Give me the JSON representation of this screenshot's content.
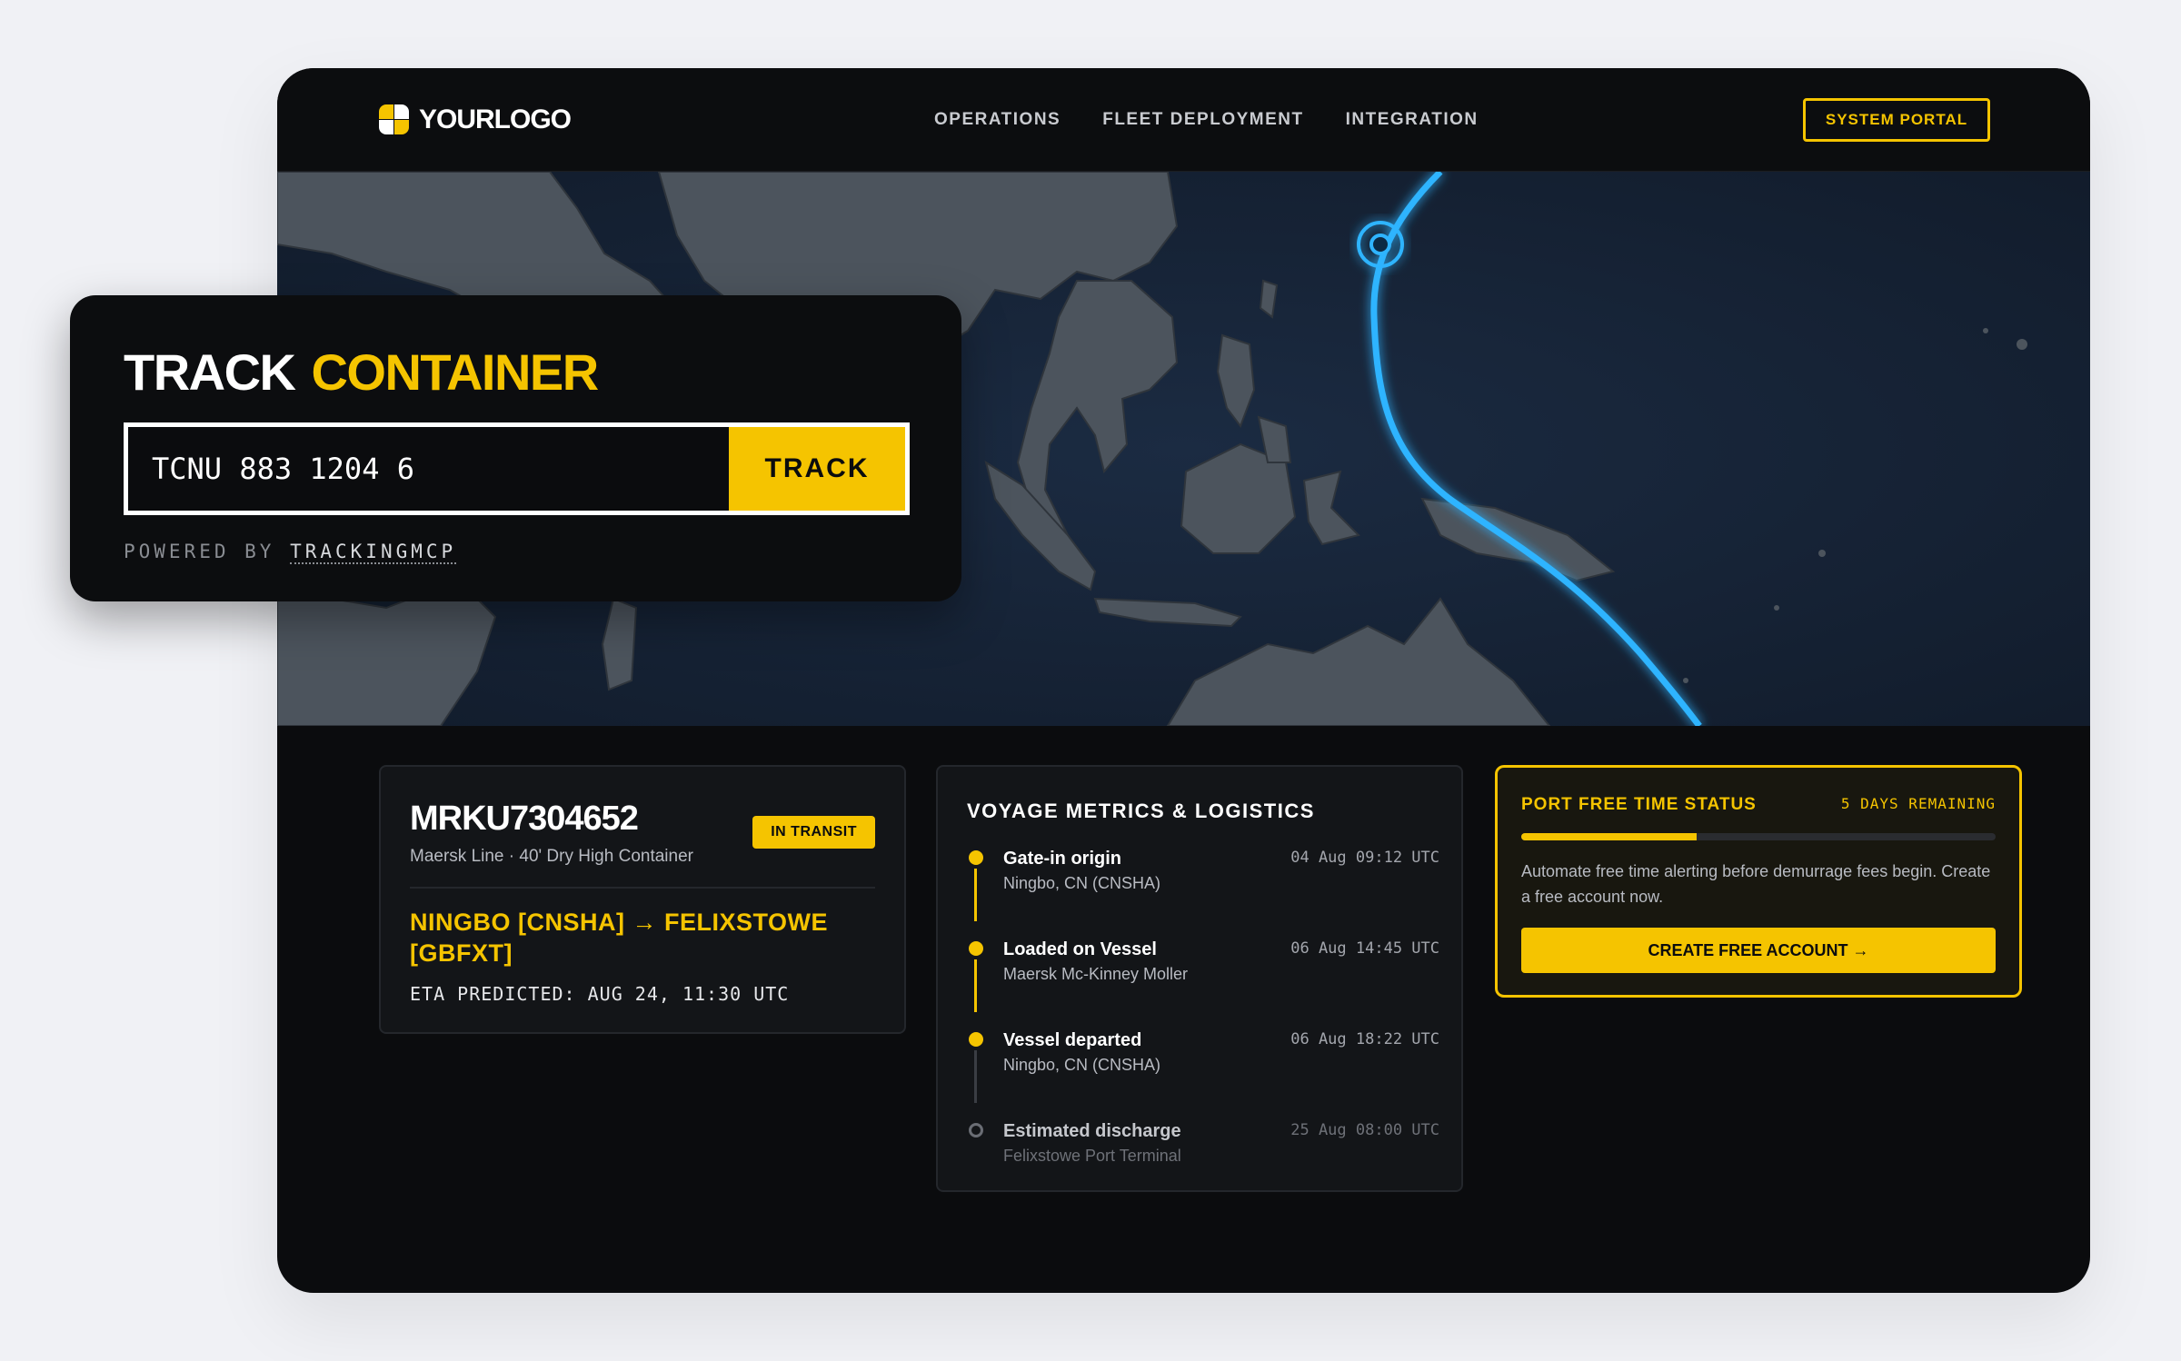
{
  "nav": {
    "logo_text": "YOURLOGO",
    "links": [
      "OPERATIONS",
      "FLEET DEPLOYMENT",
      "INTEGRATION"
    ],
    "portal_button": "SYSTEM PORTAL"
  },
  "track": {
    "title_white": "TRACK",
    "title_yellow": "CONTAINER",
    "input_value": "TCNU 883 1204 6",
    "button": "TRACK",
    "powered_prefix": "POWERED BY",
    "powered_link": "TRACKINGMCP"
  },
  "container": {
    "id": "MRKU7304652",
    "subtitle": "Maersk Line · 40' Dry High Container",
    "badge": "IN TRANSIT",
    "route": "NINGBO [CNSHA] → FELIXSTOWE [GBFXT]",
    "eta": "ETA PREDICTED: AUG 24, 11:30 UTC"
  },
  "voyage": {
    "title": "VOYAGE METRICS & LOGISTICS",
    "events": [
      {
        "title": "Gate-in origin",
        "sub": "Ningbo, CN (CNSHA)",
        "time": "04 Aug 09:12 UTC",
        "status": "done"
      },
      {
        "title": "Loaded on Vessel",
        "sub": "Maersk Mc-Kinney Moller",
        "time": "06 Aug 14:45 UTC",
        "status": "done"
      },
      {
        "title": "Vessel departed",
        "sub": "Ningbo, CN (CNSHA)",
        "time": "06 Aug 18:22 UTC",
        "status": "done"
      },
      {
        "title": "Estimated discharge",
        "sub": "Felixstowe Port Terminal",
        "time": "25 Aug 08:00 UTC",
        "status": "future"
      }
    ]
  },
  "freetime": {
    "title": "PORT FREE TIME STATUS",
    "days": "5 DAYS REMAINING",
    "progress": 0.37,
    "text": "Automate free time alerting before demurrage fees begin. Create a free account now.",
    "button": "CREATE FREE ACCOUNT →"
  },
  "colors": {
    "accent": "#f5c400",
    "background": "#0b0c0e",
    "route_line": "#2fb4ff"
  }
}
